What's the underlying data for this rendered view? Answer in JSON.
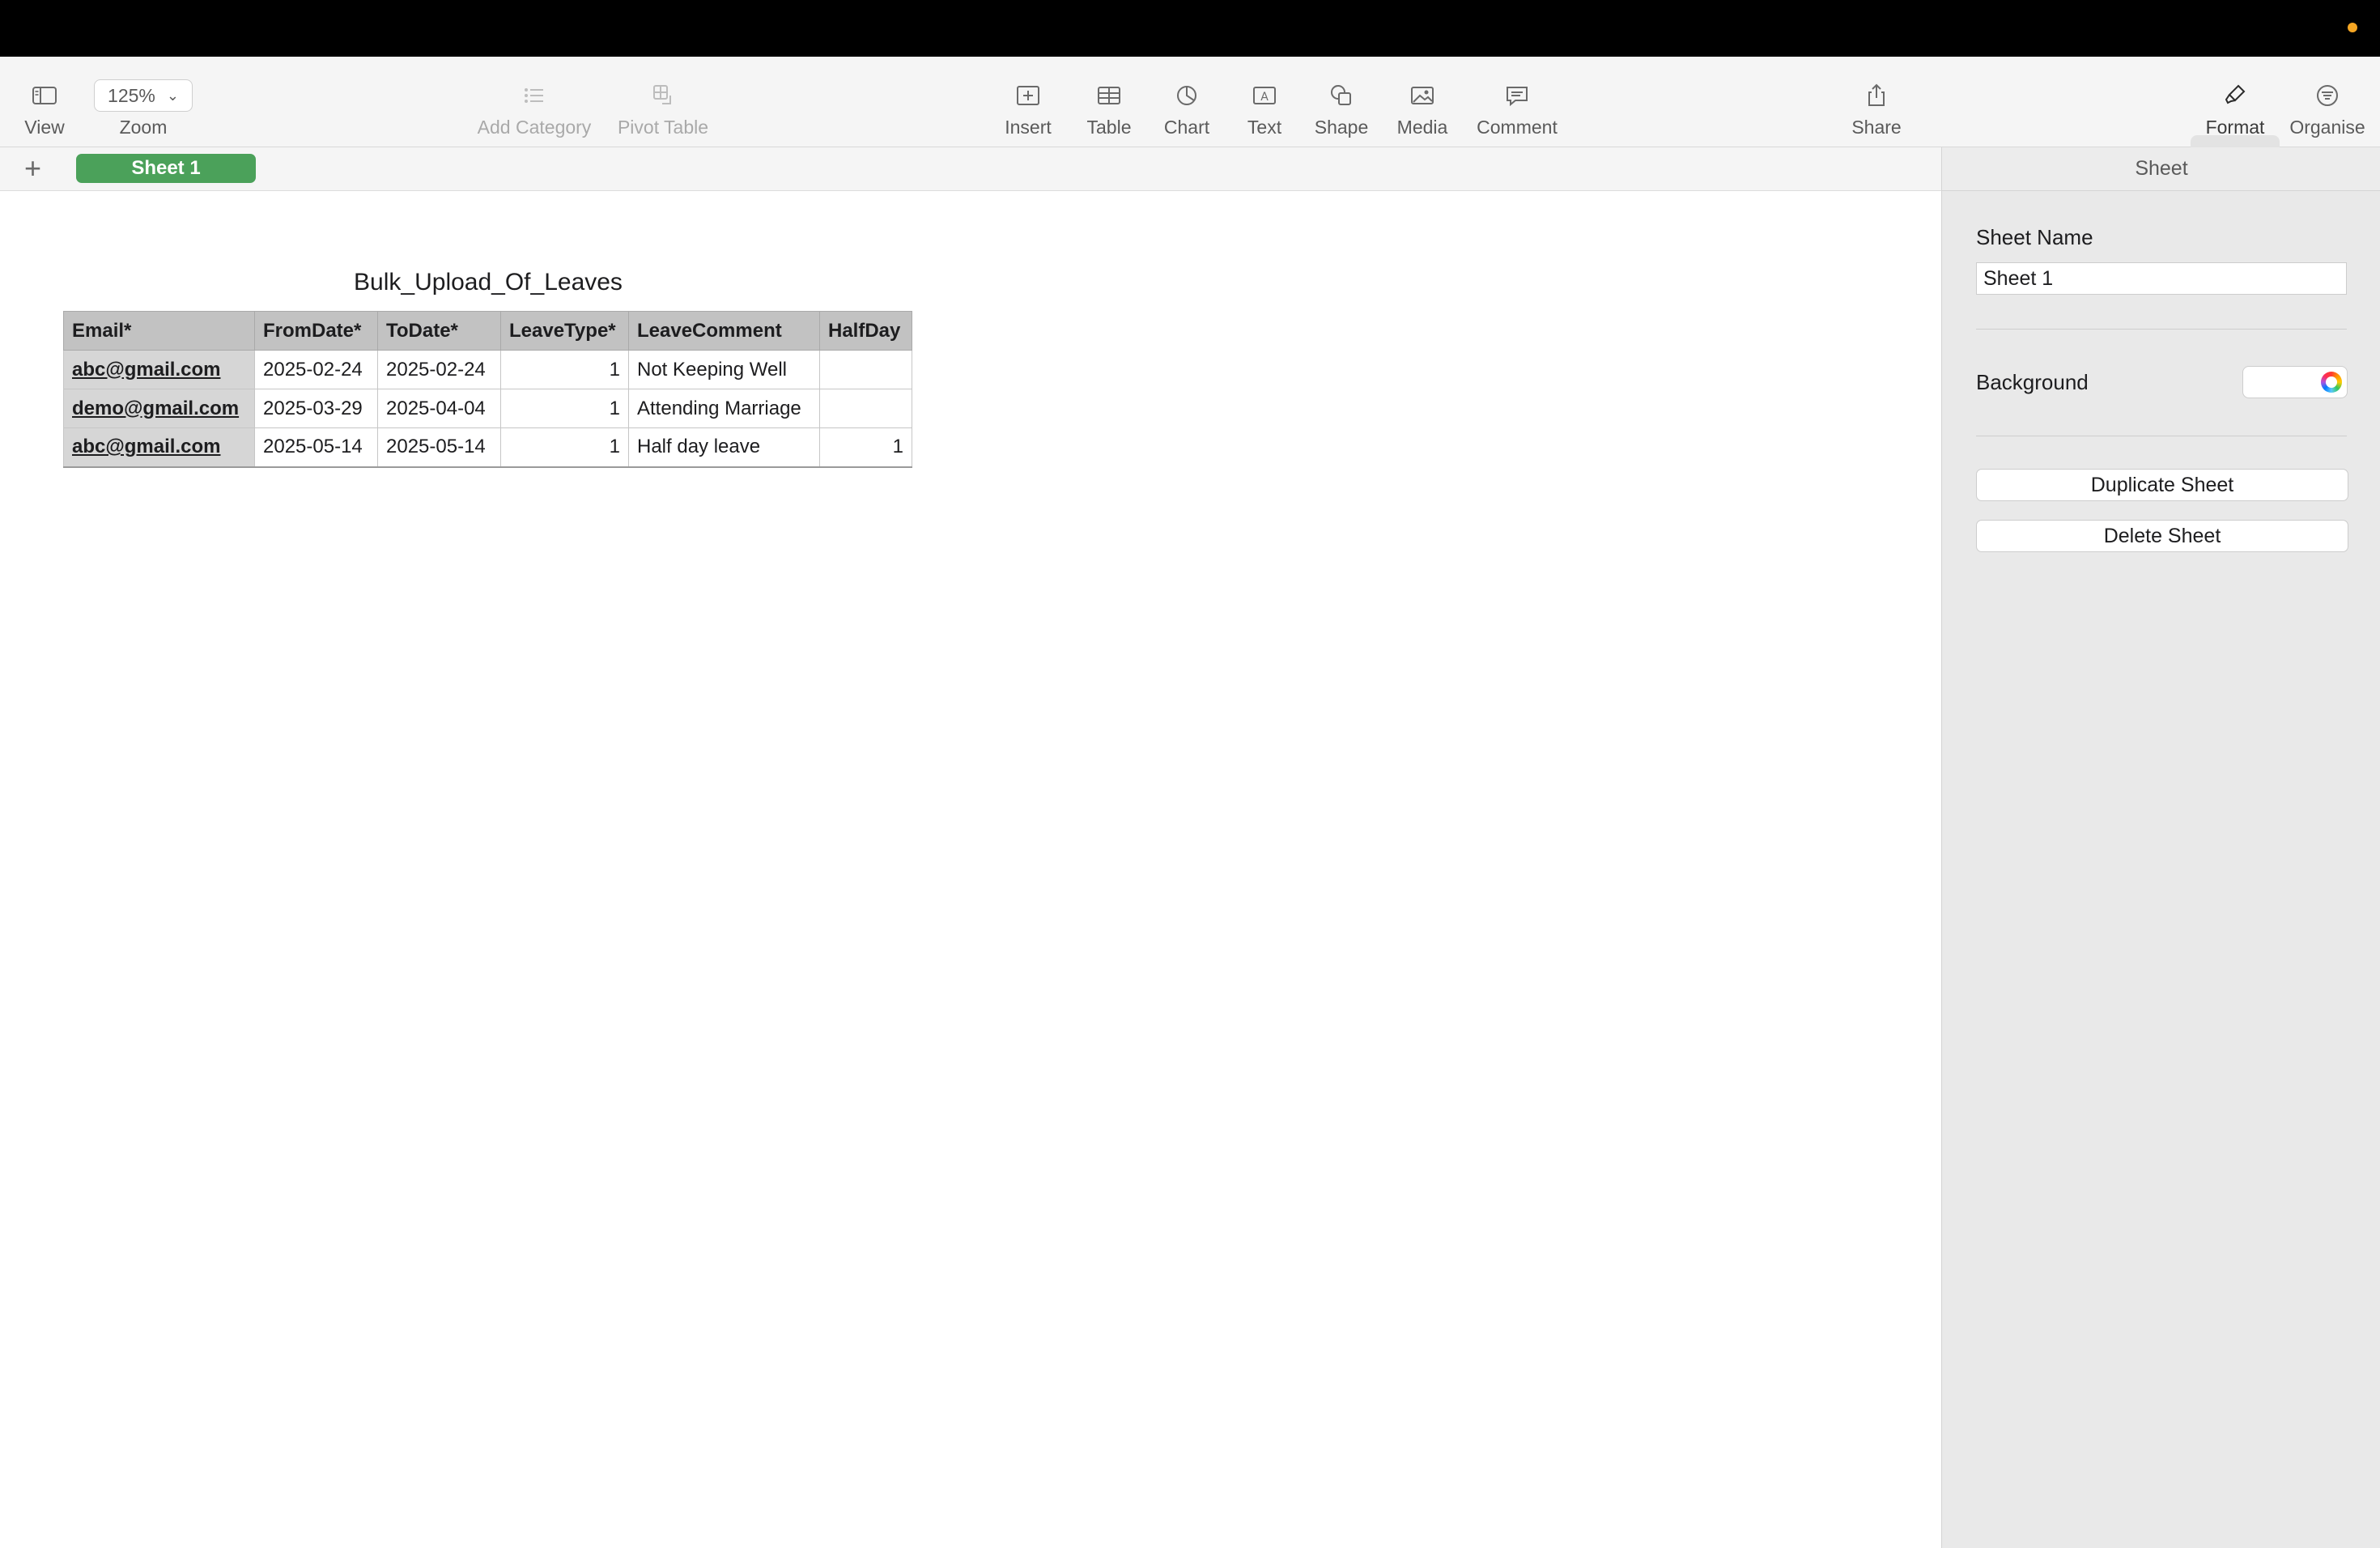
{
  "toolbar": {
    "view": {
      "label": "View",
      "icon": "sidebar-icon"
    },
    "zoom": {
      "label": "Zoom",
      "value": "125%"
    },
    "add_category": {
      "label": "Add Category",
      "icon": "list-icon"
    },
    "pivot_table": {
      "label": "Pivot Table",
      "icon": "pivot-icon"
    },
    "insert": {
      "label": "Insert",
      "icon": "insert-icon"
    },
    "table": {
      "label": "Table",
      "icon": "table-icon"
    },
    "chart": {
      "label": "Chart",
      "icon": "chart-icon"
    },
    "text": {
      "label": "Text",
      "icon": "text-icon"
    },
    "shape": {
      "label": "Shape",
      "icon": "shape-icon"
    },
    "media": {
      "label": "Media",
      "icon": "media-icon"
    },
    "comment": {
      "label": "Comment",
      "icon": "comment-icon"
    },
    "share": {
      "label": "Share",
      "icon": "share-icon"
    },
    "format": {
      "label": "Format",
      "icon": "paintbrush-icon"
    },
    "organise": {
      "label": "Organise",
      "icon": "filter-icon"
    }
  },
  "tabs": {
    "add_symbol": "+",
    "active": "Sheet 1"
  },
  "table": {
    "title": "Bulk_Upload_Of_Leaves",
    "headers": [
      "Email*",
      "FromDate*",
      "ToDate*",
      "LeaveType*",
      "LeaveComment",
      "HalfDay"
    ],
    "rows": [
      [
        "abc@gmail.com",
        "2025-02-24",
        "2025-02-24",
        "1",
        "Not Keeping Well",
        ""
      ],
      [
        "demo@gmail.com",
        "2025-03-29",
        "2025-04-04",
        "1",
        "Attending Marriage",
        ""
      ],
      [
        "abc@gmail.com",
        "2025-05-14",
        "2025-05-14",
        "1",
        "Half day leave",
        "1"
      ]
    ]
  },
  "sidebar": {
    "header": "Sheet",
    "sheet_name_label": "Sheet Name",
    "sheet_name_value": "Sheet 1",
    "background_label": "Background",
    "background_color": "#ffffff",
    "duplicate_label": "Duplicate Sheet",
    "delete_label": "Delete Sheet"
  },
  "colors": {
    "tab_active": "#4ba15a",
    "header_fill": "#c2c2c2",
    "email_fill": "#d6d6d6"
  }
}
